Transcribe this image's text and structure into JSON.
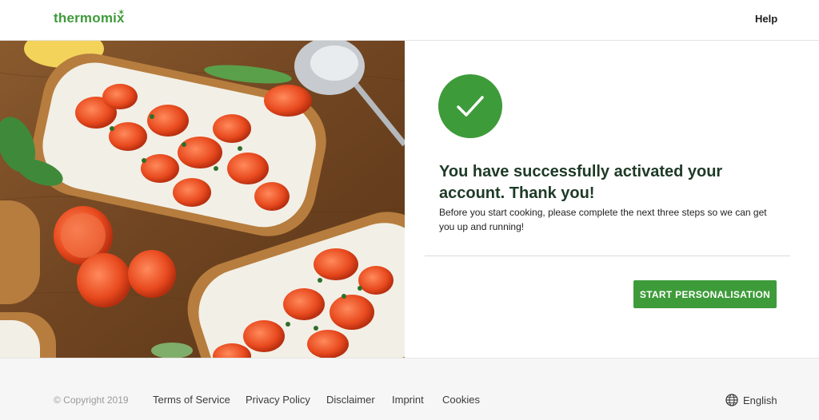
{
  "header": {
    "logo_text": "thermomix",
    "help_label": "Help"
  },
  "hero": {
    "image_description_icon": "bruschetta-photo"
  },
  "confirmation": {
    "icon": "checkmark-icon",
    "headline": "You have successfully activated your account. Thank you!",
    "body": "Before you start cooking, please complete the next three steps so we can get you up and running!",
    "button_label": "START PERSONALISATION"
  },
  "footer": {
    "copyright": "© Copyright 2019",
    "links": [
      "Terms of Service",
      "Privacy Policy",
      "Disclaimer",
      "Imprint",
      "Cookies"
    ],
    "language": "English"
  },
  "colors": {
    "brand_green": "#3e9b3a",
    "headline": "#1e3a26"
  }
}
